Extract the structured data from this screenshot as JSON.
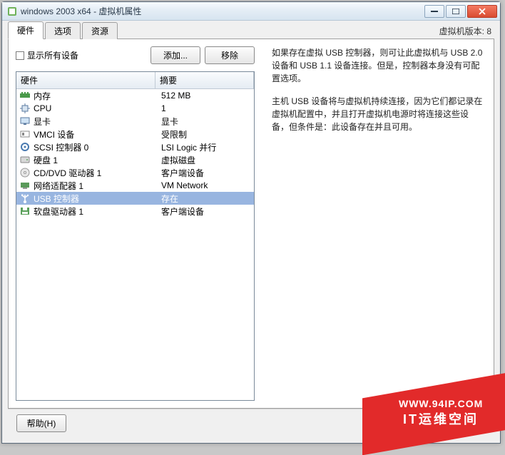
{
  "titlebar": {
    "title": "windows 2003 x64 - 虚拟机属性"
  },
  "tabs": {
    "hardware": "硬件",
    "options": "选项",
    "resources": "资源"
  },
  "version_label": "虚拟机版本: 8",
  "controls": {
    "show_all_devices": "显示所有设备",
    "add": "添加...",
    "remove": "移除",
    "help": "帮助(H)"
  },
  "columns": {
    "hardware": "硬件",
    "summary": "摘要"
  },
  "hardware_rows": [
    {
      "icon": "memory-icon",
      "name": "内存",
      "summary": "512 MB",
      "selected": false
    },
    {
      "icon": "cpu-icon",
      "name": "CPU",
      "summary": "1",
      "selected": false
    },
    {
      "icon": "video-icon",
      "name": "显卡",
      "summary": "显卡",
      "selected": false
    },
    {
      "icon": "vmci-icon",
      "name": "VMCI 设备",
      "summary": "受限制",
      "selected": false
    },
    {
      "icon": "scsi-icon",
      "name": "SCSI 控制器 0",
      "summary": "LSI Logic 并行",
      "selected": false
    },
    {
      "icon": "disk-icon",
      "name": "硬盘 1",
      "summary": "虚拟磁盘",
      "selected": false
    },
    {
      "icon": "cd-icon",
      "name": "CD/DVD 驱动器 1",
      "summary": "客户端设备",
      "selected": false
    },
    {
      "icon": "nic-icon",
      "name": "网络适配器 1",
      "summary": "VM Network",
      "selected": false
    },
    {
      "icon": "usb-icon",
      "name": "USB 控制器",
      "summary": "存在",
      "selected": true
    },
    {
      "icon": "floppy-icon",
      "name": "软盘驱动器 1",
      "summary": "客户端设备",
      "selected": false
    }
  ],
  "right": {
    "p1": "如果存在虚拟 USB 控制器，则可让此虚拟机与 USB 2.0 设备和 USB 1.1 设备连接。但是，控制器本身没有可配置选项。",
    "p2": "主机 USB 设备将与虚拟机持续连接，因为它们都记录在虚拟机配置中，并且打开虚拟机电源时将连接这些设备，但条件是：此设备存在并且可用。"
  },
  "watermark": {
    "url": "WWW.94IP.COM",
    "text": "IT运维空间"
  }
}
